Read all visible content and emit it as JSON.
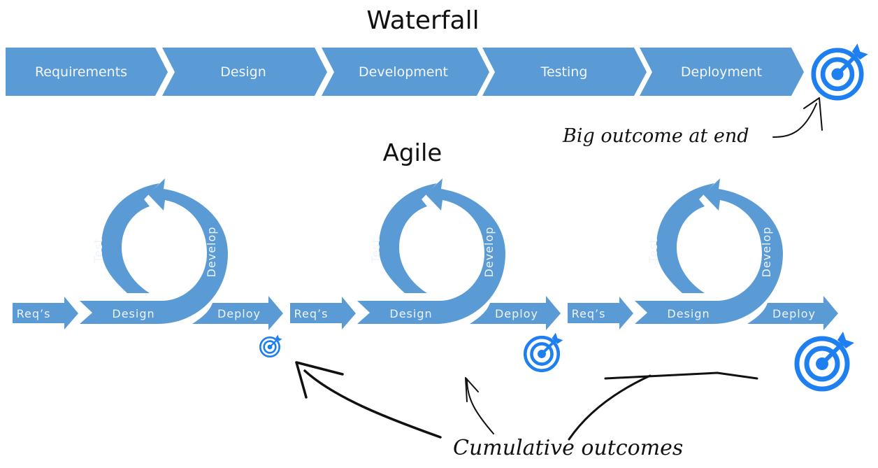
{
  "colors": {
    "shape_fill": "#5b9bd5",
    "shape_fill_dark": "#4f8fca",
    "target_blue": "#1e7ff0",
    "ink": "#111111",
    "label_text": "#f3f7fc"
  },
  "waterfall": {
    "title": "Waterfall",
    "stages": [
      "Requirements",
      "Design",
      "Development",
      "Testing",
      "Deployment"
    ],
    "outcome_icon": "target-icon",
    "annotation": "Big outcome at end"
  },
  "agile": {
    "title": "Agile",
    "iterations": [
      {
        "labels": {
          "requirements": "Req’s",
          "design": "Design",
          "develop": "Develop",
          "test": "Test",
          "deploy": "Deploy"
        },
        "outcome_icon": "target-icon",
        "outcome_size": "small"
      },
      {
        "labels": {
          "requirements": "Req’s",
          "design": "Design",
          "develop": "Develop",
          "test": "Test",
          "deploy": "Deploy"
        },
        "outcome_icon": "target-icon",
        "outcome_size": "medium"
      },
      {
        "labels": {
          "requirements": "Req’s",
          "design": "Design",
          "develop": "Develop",
          "test": "Test",
          "deploy": "Deploy"
        },
        "outcome_icon": "target-icon",
        "outcome_size": "large"
      }
    ],
    "annotation": "Cumulative outcomes"
  }
}
